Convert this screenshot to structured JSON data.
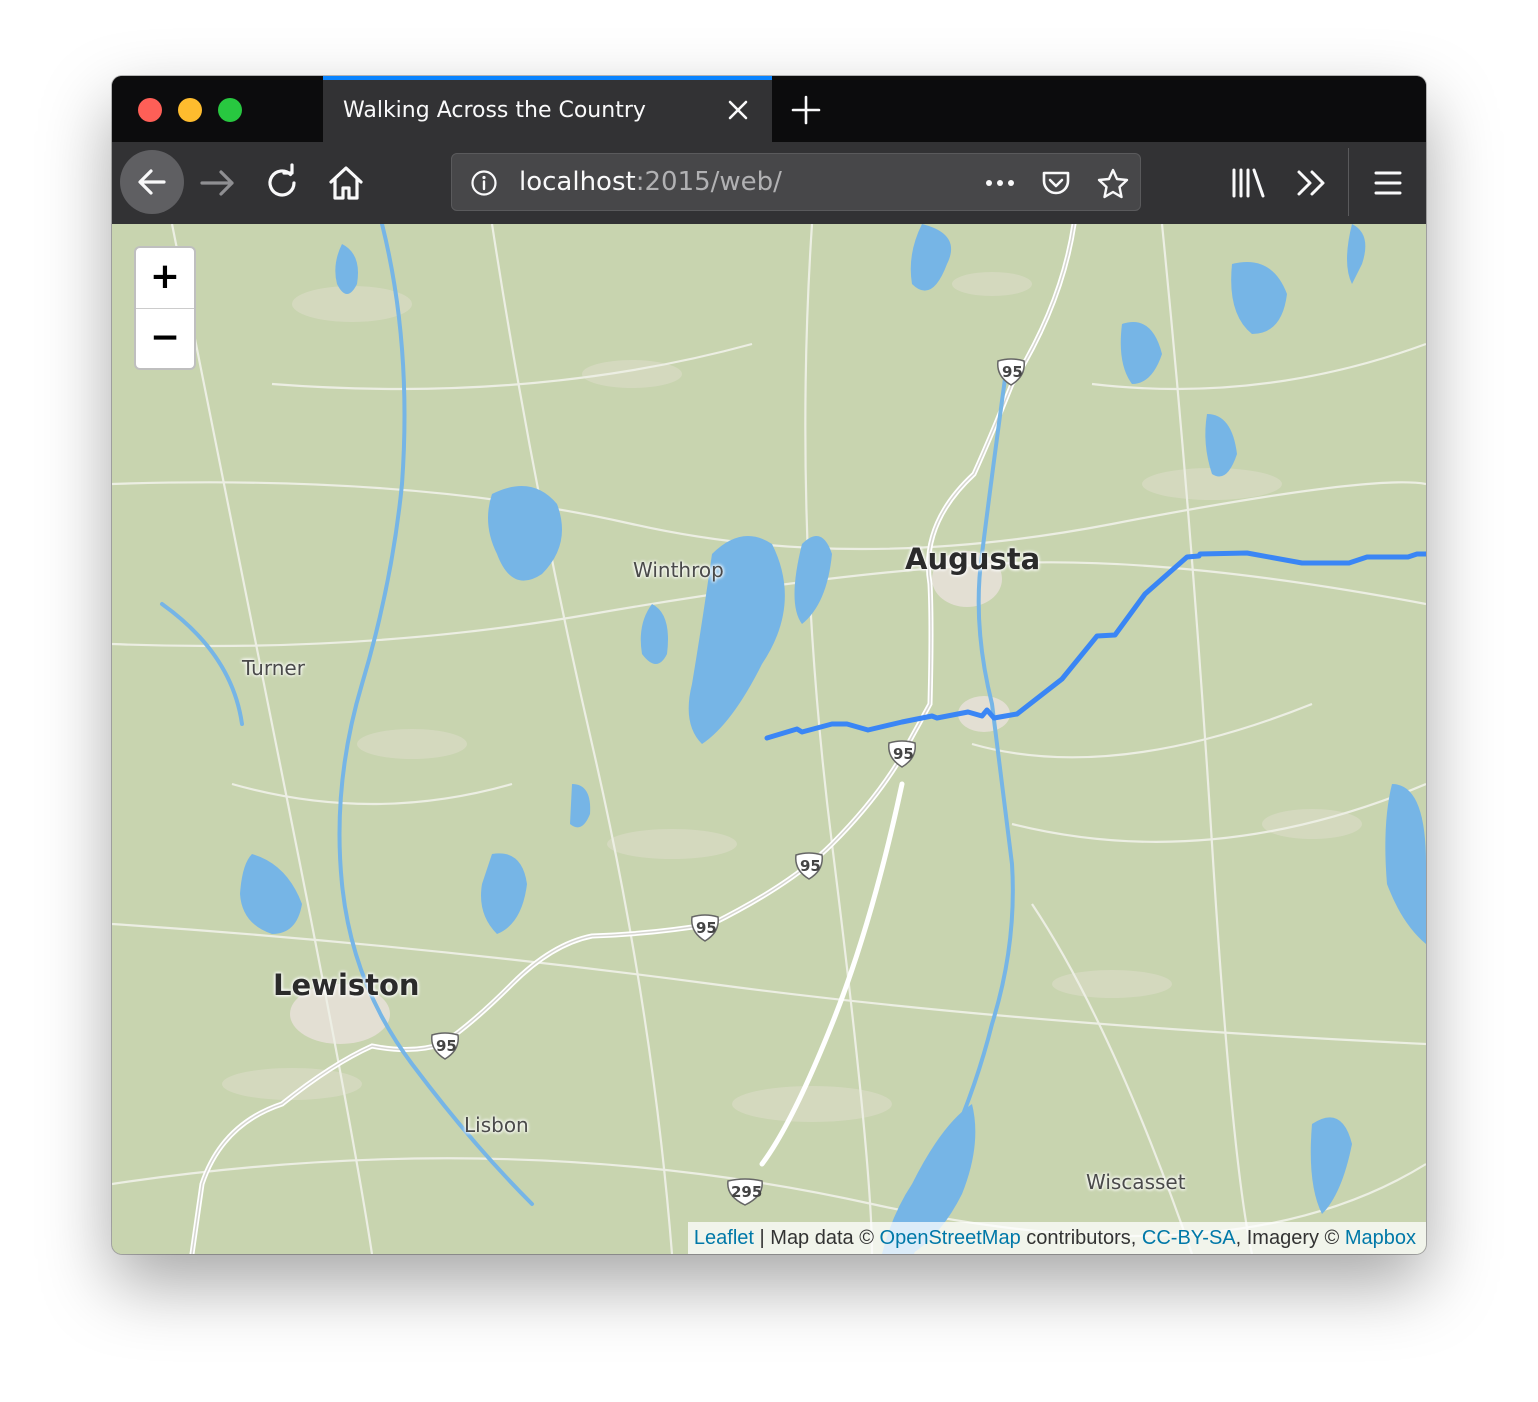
{
  "browser": {
    "tab_title": "Walking Across the Country",
    "url_host": "localhost",
    "url_rest": ":2015/web/"
  },
  "icons": {
    "back": "arrow-left-icon",
    "forward": "arrow-right-icon",
    "reload": "reload-icon",
    "home": "home-icon",
    "info": "info-icon",
    "more": "ellipsis-icon",
    "pocket": "pocket-icon",
    "bookmark": "star-icon",
    "library": "library-icon",
    "overflow": "chevron-double-right-icon",
    "menu": "hamburger-menu-icon",
    "close_tab": "close-icon",
    "new_tab": "plus-icon"
  },
  "map": {
    "zoom_in_label": "+",
    "zoom_out_label": "−",
    "places": {
      "augusta": "Augusta",
      "winthrop": "Winthrop",
      "turner": "Turner",
      "lewiston": "Lewiston",
      "lisbon": "Lisbon",
      "wiscasset": "Wiscasset"
    },
    "shields": {
      "i95_a": "95",
      "i95_b": "95",
      "i95_c": "95",
      "i95_d": "95",
      "i95_e": "95",
      "i295": "295"
    },
    "route_color": "#3a86f5",
    "water_color": "#76b5e6",
    "land_color": "#c9d4b0"
  },
  "attribution": {
    "leaflet": "Leaflet",
    "sep": " | Map data © ",
    "osm": "OpenStreetMap",
    "contributors": " contributors, ",
    "license": "CC-BY-SA",
    "imagery": ", Imagery © ",
    "mapbox": "Mapbox"
  }
}
